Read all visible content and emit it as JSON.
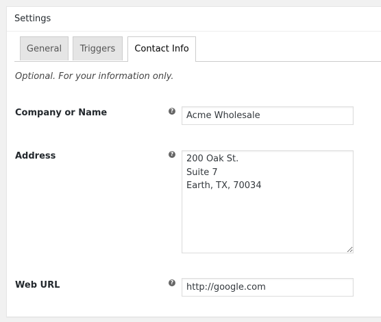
{
  "panel": {
    "title": "Settings"
  },
  "tabs": [
    {
      "label": "General",
      "active": false
    },
    {
      "label": "Triggers",
      "active": false
    },
    {
      "label": "Contact Info",
      "active": true
    }
  ],
  "intro": "Optional. For your information only.",
  "fields": {
    "company": {
      "label": "Company or Name",
      "value": "Acme Wholesale"
    },
    "address": {
      "label": "Address",
      "value": "200 Oak St.\nSuite 7\nEarth, TX, 70034"
    },
    "web_url": {
      "label": "Web URL",
      "value": "http://google.com"
    }
  },
  "help_icon": {
    "glyph": "?",
    "icon": "question-mark-icon",
    "color": "#666666"
  }
}
